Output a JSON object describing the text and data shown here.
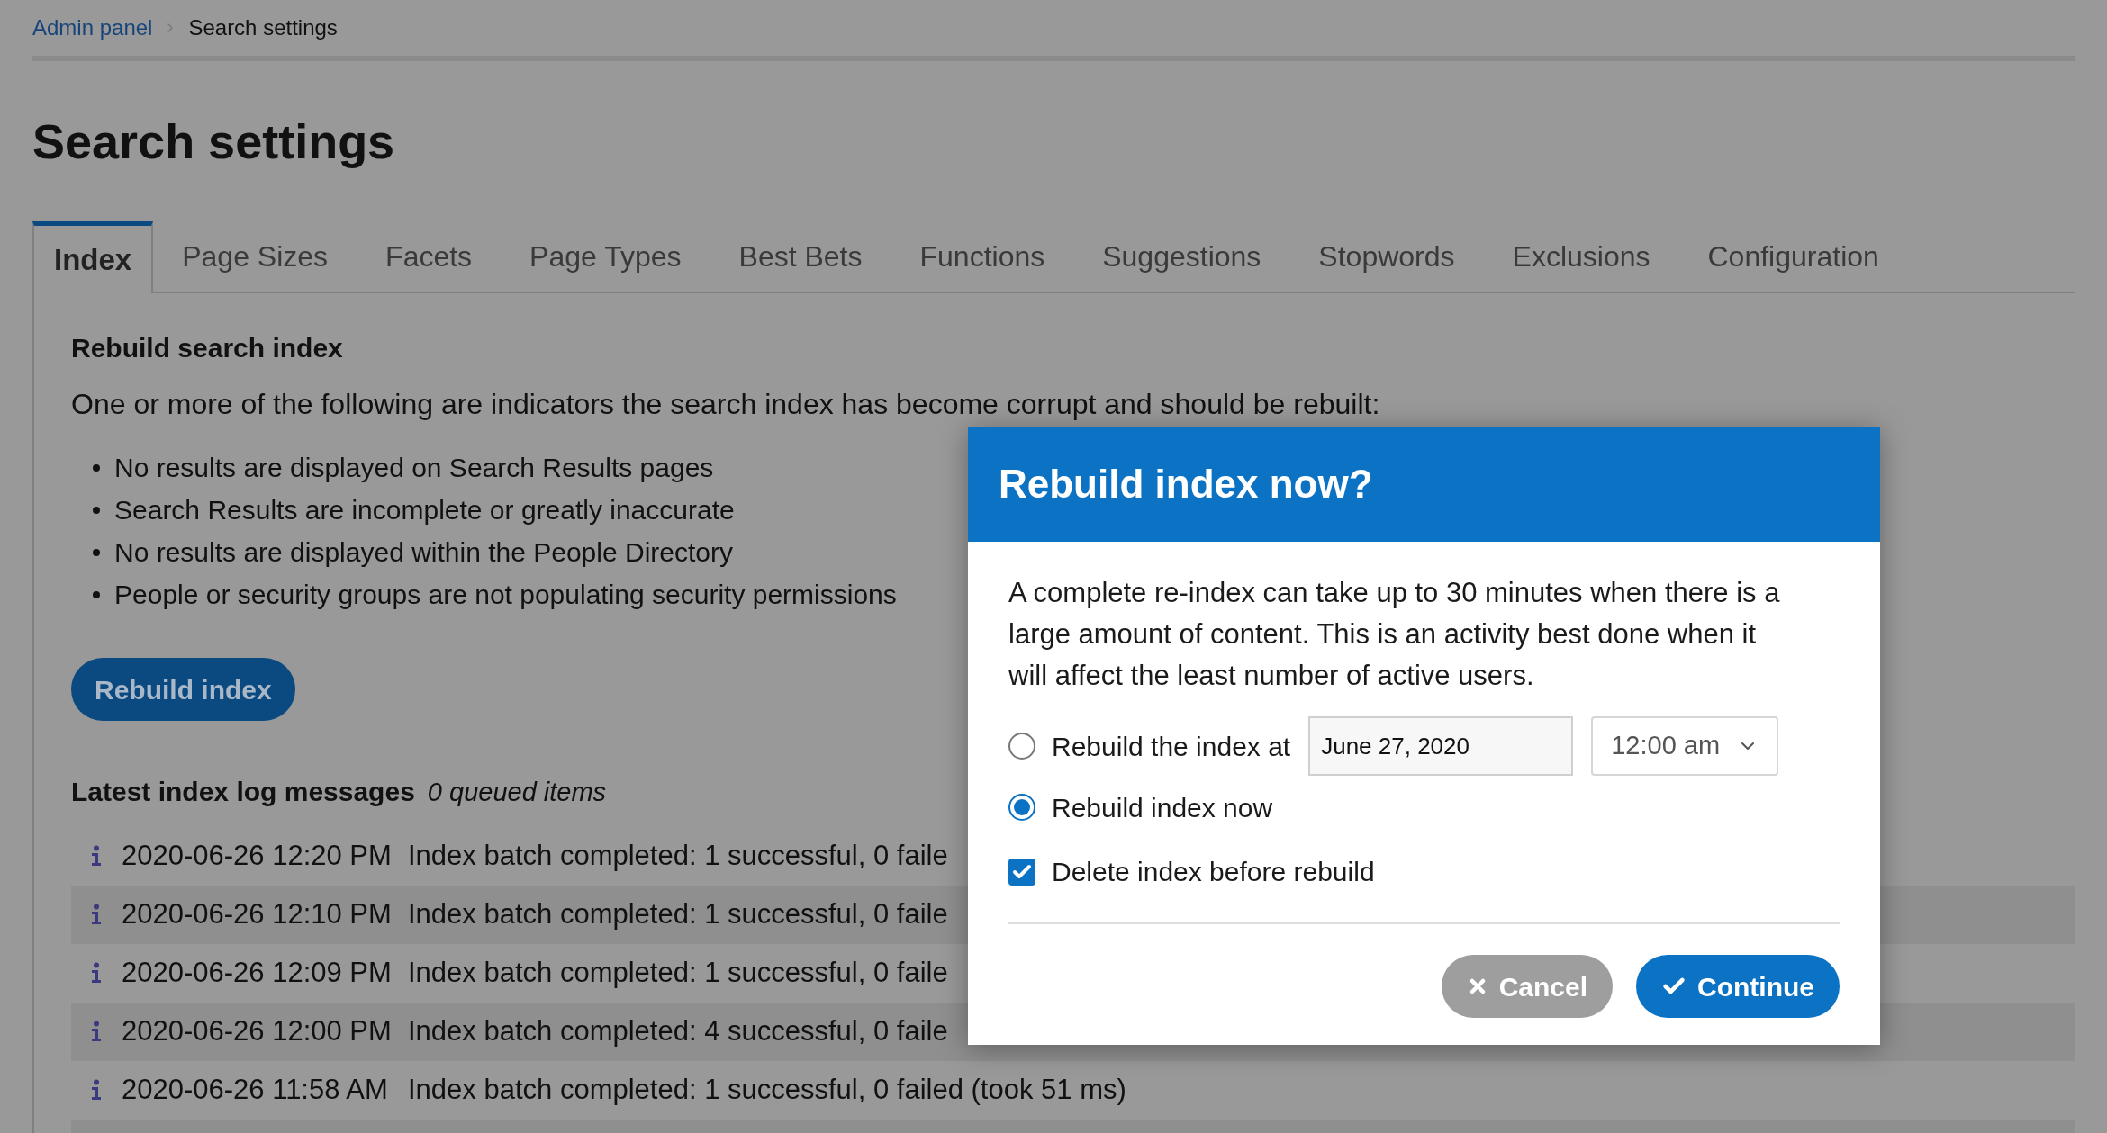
{
  "breadcrumb": [
    {
      "label": "Admin panel",
      "kind": "link"
    },
    {
      "label": "Search settings",
      "kind": "current"
    }
  ],
  "title": "Search settings",
  "tabs": [
    {
      "label": "Index",
      "selected": true
    },
    {
      "label": "Page Sizes",
      "selected": false
    },
    {
      "label": "Facets",
      "selected": false
    },
    {
      "label": "Page Types",
      "selected": false
    },
    {
      "label": "Best Bets",
      "selected": false
    },
    {
      "label": "Functions",
      "selected": false
    },
    {
      "label": "Suggestions",
      "selected": false
    },
    {
      "label": "Stopwords",
      "selected": false
    },
    {
      "label": "Exclusions",
      "selected": false
    },
    {
      "label": "Configuration",
      "selected": false
    }
  ],
  "rebuild": {
    "heading": "Rebuild search index",
    "intro": "One or more of the following are indicators the search index has become corrupt and should be rebuilt:",
    "bullets": [
      "No results are displayed on Search Results pages",
      "Search Results are incomplete or greatly inaccurate",
      "No results are displayed within the People Directory",
      "People or security groups are not populating security permissions"
    ],
    "button": "Rebuild index"
  },
  "log": {
    "heading": "Latest index log messages",
    "queued": "0 queued items",
    "rows": [
      {
        "time": "2020-06-26 12:20 PM",
        "message": "Index batch completed: 1 successful, 0 faile"
      },
      {
        "time": "2020-06-26 12:10 PM",
        "message": "Index batch completed: 1 successful, 0 faile"
      },
      {
        "time": "2020-06-26 12:09 PM",
        "message": "Index batch completed: 1 successful, 0 faile"
      },
      {
        "time": "2020-06-26 12:00 PM",
        "message": "Index batch completed: 4 successful, 0 faile"
      },
      {
        "time": "2020-06-26 11:58 AM",
        "message": "Index batch completed: 1 successful, 0 failed (took 51 ms)"
      }
    ]
  },
  "dialog": {
    "title": "Rebuild index now?",
    "text": "A complete re-index can take up to 30 minutes when there is a large amount of content. This is an activity best done when it will affect the least number of active users.",
    "options": [
      {
        "kind": "scheduled",
        "label": "Rebuild the index at",
        "selected": false,
        "date": "June 27, 2020",
        "time": "12:00 am"
      },
      {
        "kind": "now",
        "label": "Rebuild index now",
        "selected": true
      }
    ],
    "checkbox": {
      "label": "Delete index before rebuild",
      "checked": true
    },
    "buttons": [
      {
        "label": "Cancel",
        "kind": "secondary"
      },
      {
        "label": "Continue",
        "kind": "primary"
      }
    ]
  }
}
